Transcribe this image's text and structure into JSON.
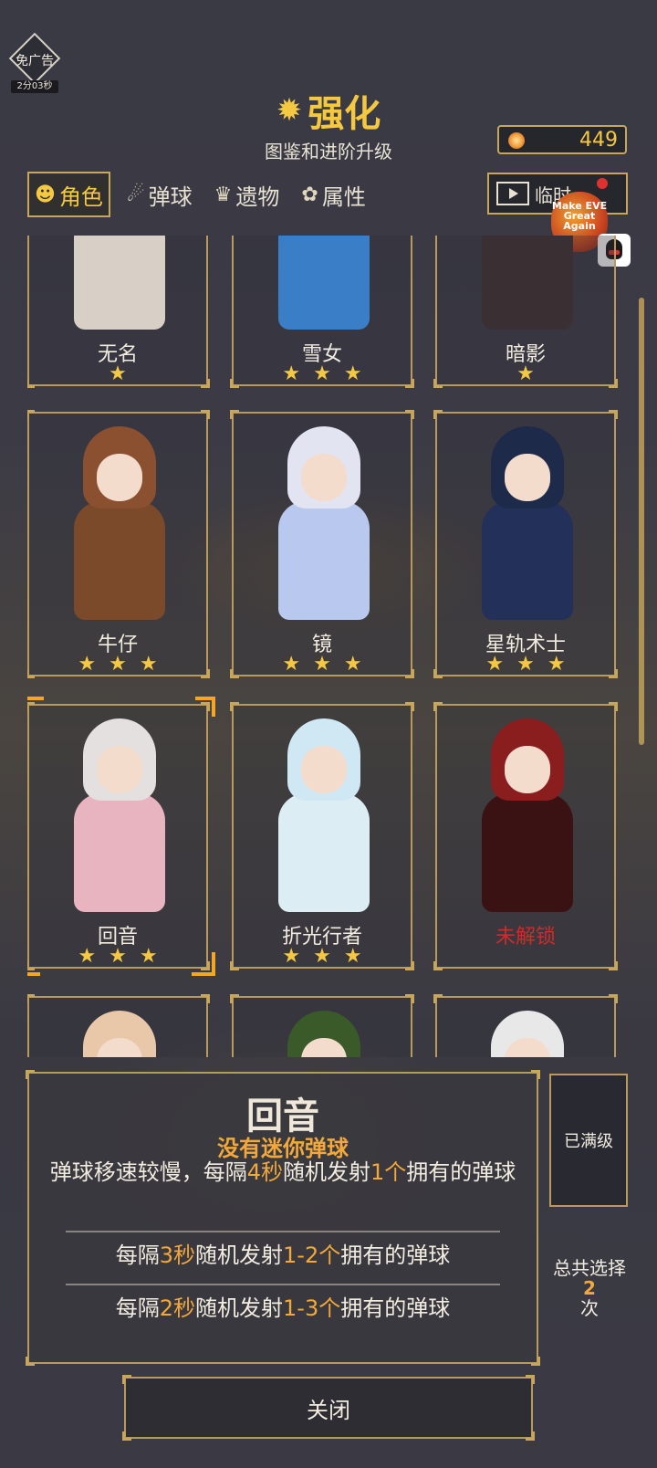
{
  "ad": {
    "label": "免广告",
    "timer": "2分03秒"
  },
  "header": {
    "title": "强化",
    "subtitle": "图鉴和进阶升级"
  },
  "currency": {
    "value": "449"
  },
  "tabs": [
    {
      "label": "角色",
      "icon": "character-icon",
      "active": true
    },
    {
      "label": "弹球",
      "icon": "ball-icon",
      "active": false
    },
    {
      "label": "遗物",
      "icon": "relic-icon",
      "active": false
    },
    {
      "label": "属性",
      "icon": "attribute-icon",
      "active": false
    }
  ],
  "video_button": {
    "label": "临时"
  },
  "promo": {
    "text": "Make EVE Great Again"
  },
  "characters": [
    {
      "name": "无名",
      "stars": "★",
      "hair": "#e8ddd2",
      "robe": "#d8cfc6",
      "locked": false
    },
    {
      "name": "雪女",
      "stars": "★★★",
      "hair": "#bcd8f0",
      "robe": "#3a7ec8",
      "locked": false
    },
    {
      "name": "暗影",
      "stars": "★",
      "hair": "#2a2224",
      "robe": "#3a3034",
      "locked": false
    },
    {
      "name": "牛仔",
      "stars": "★★★",
      "hair": "#8a5030",
      "robe": "#7a4a2a",
      "locked": false
    },
    {
      "name": "镜",
      "stars": "★★★",
      "hair": "#e2e4f2",
      "robe": "#b8c8ee",
      "locked": false
    },
    {
      "name": "星轨术士",
      "stars": "★★★",
      "hair": "#1e2a4a",
      "robe": "#22305a",
      "locked": false
    },
    {
      "name": "回音",
      "stars": "★★★",
      "hair": "#e4e0e0",
      "robe": "#e8b4c0",
      "locked": false
    },
    {
      "name": "折光行者",
      "stars": "★★★",
      "hair": "#cfe8f4",
      "robe": "#dceef4",
      "locked": false
    },
    {
      "name": "未解锁",
      "stars": "",
      "hair": "#8a1e1e",
      "robe": "#3a1214",
      "locked": true
    },
    {
      "name": "",
      "stars": "",
      "hair": "#e8c8a8",
      "robe": "#3a3942",
      "locked": false
    },
    {
      "name": "",
      "stars": "",
      "hair": "#3a5a2a",
      "robe": "#3a3942",
      "locked": false
    },
    {
      "name": "",
      "stars": "",
      "hair": "#e8e8e8",
      "robe": "#3a3942",
      "locked": false
    }
  ],
  "detail": {
    "name": "回音",
    "tag": "没有迷你弹球",
    "desc_a": "弹球移速较慢，每隔",
    "desc_b": "4秒",
    "desc_c": "随机发射",
    "desc_d": "1个",
    "desc_e": "拥有的弹球",
    "upgrade1_a": "每隔",
    "upgrade1_b": "3秒",
    "upgrade1_c": "随机发射",
    "upgrade1_d": "1-2个",
    "upgrade1_e": "拥有的弹球",
    "upgrade2_a": "每隔",
    "upgrade2_b": "2秒",
    "upgrade2_c": "随机发射",
    "upgrade2_d": "1-3个",
    "upgrade2_e": "拥有的弹球"
  },
  "side": {
    "maxed": "已满级",
    "total_a": "总共选择",
    "total_num": "2",
    "total_b": "次"
  },
  "close": {
    "label": "关闭"
  },
  "colors": {
    "accent": "#f5c842",
    "highlight": "#f2a83a",
    "frame": "#b89a5e",
    "locked": "#d02a2a"
  }
}
